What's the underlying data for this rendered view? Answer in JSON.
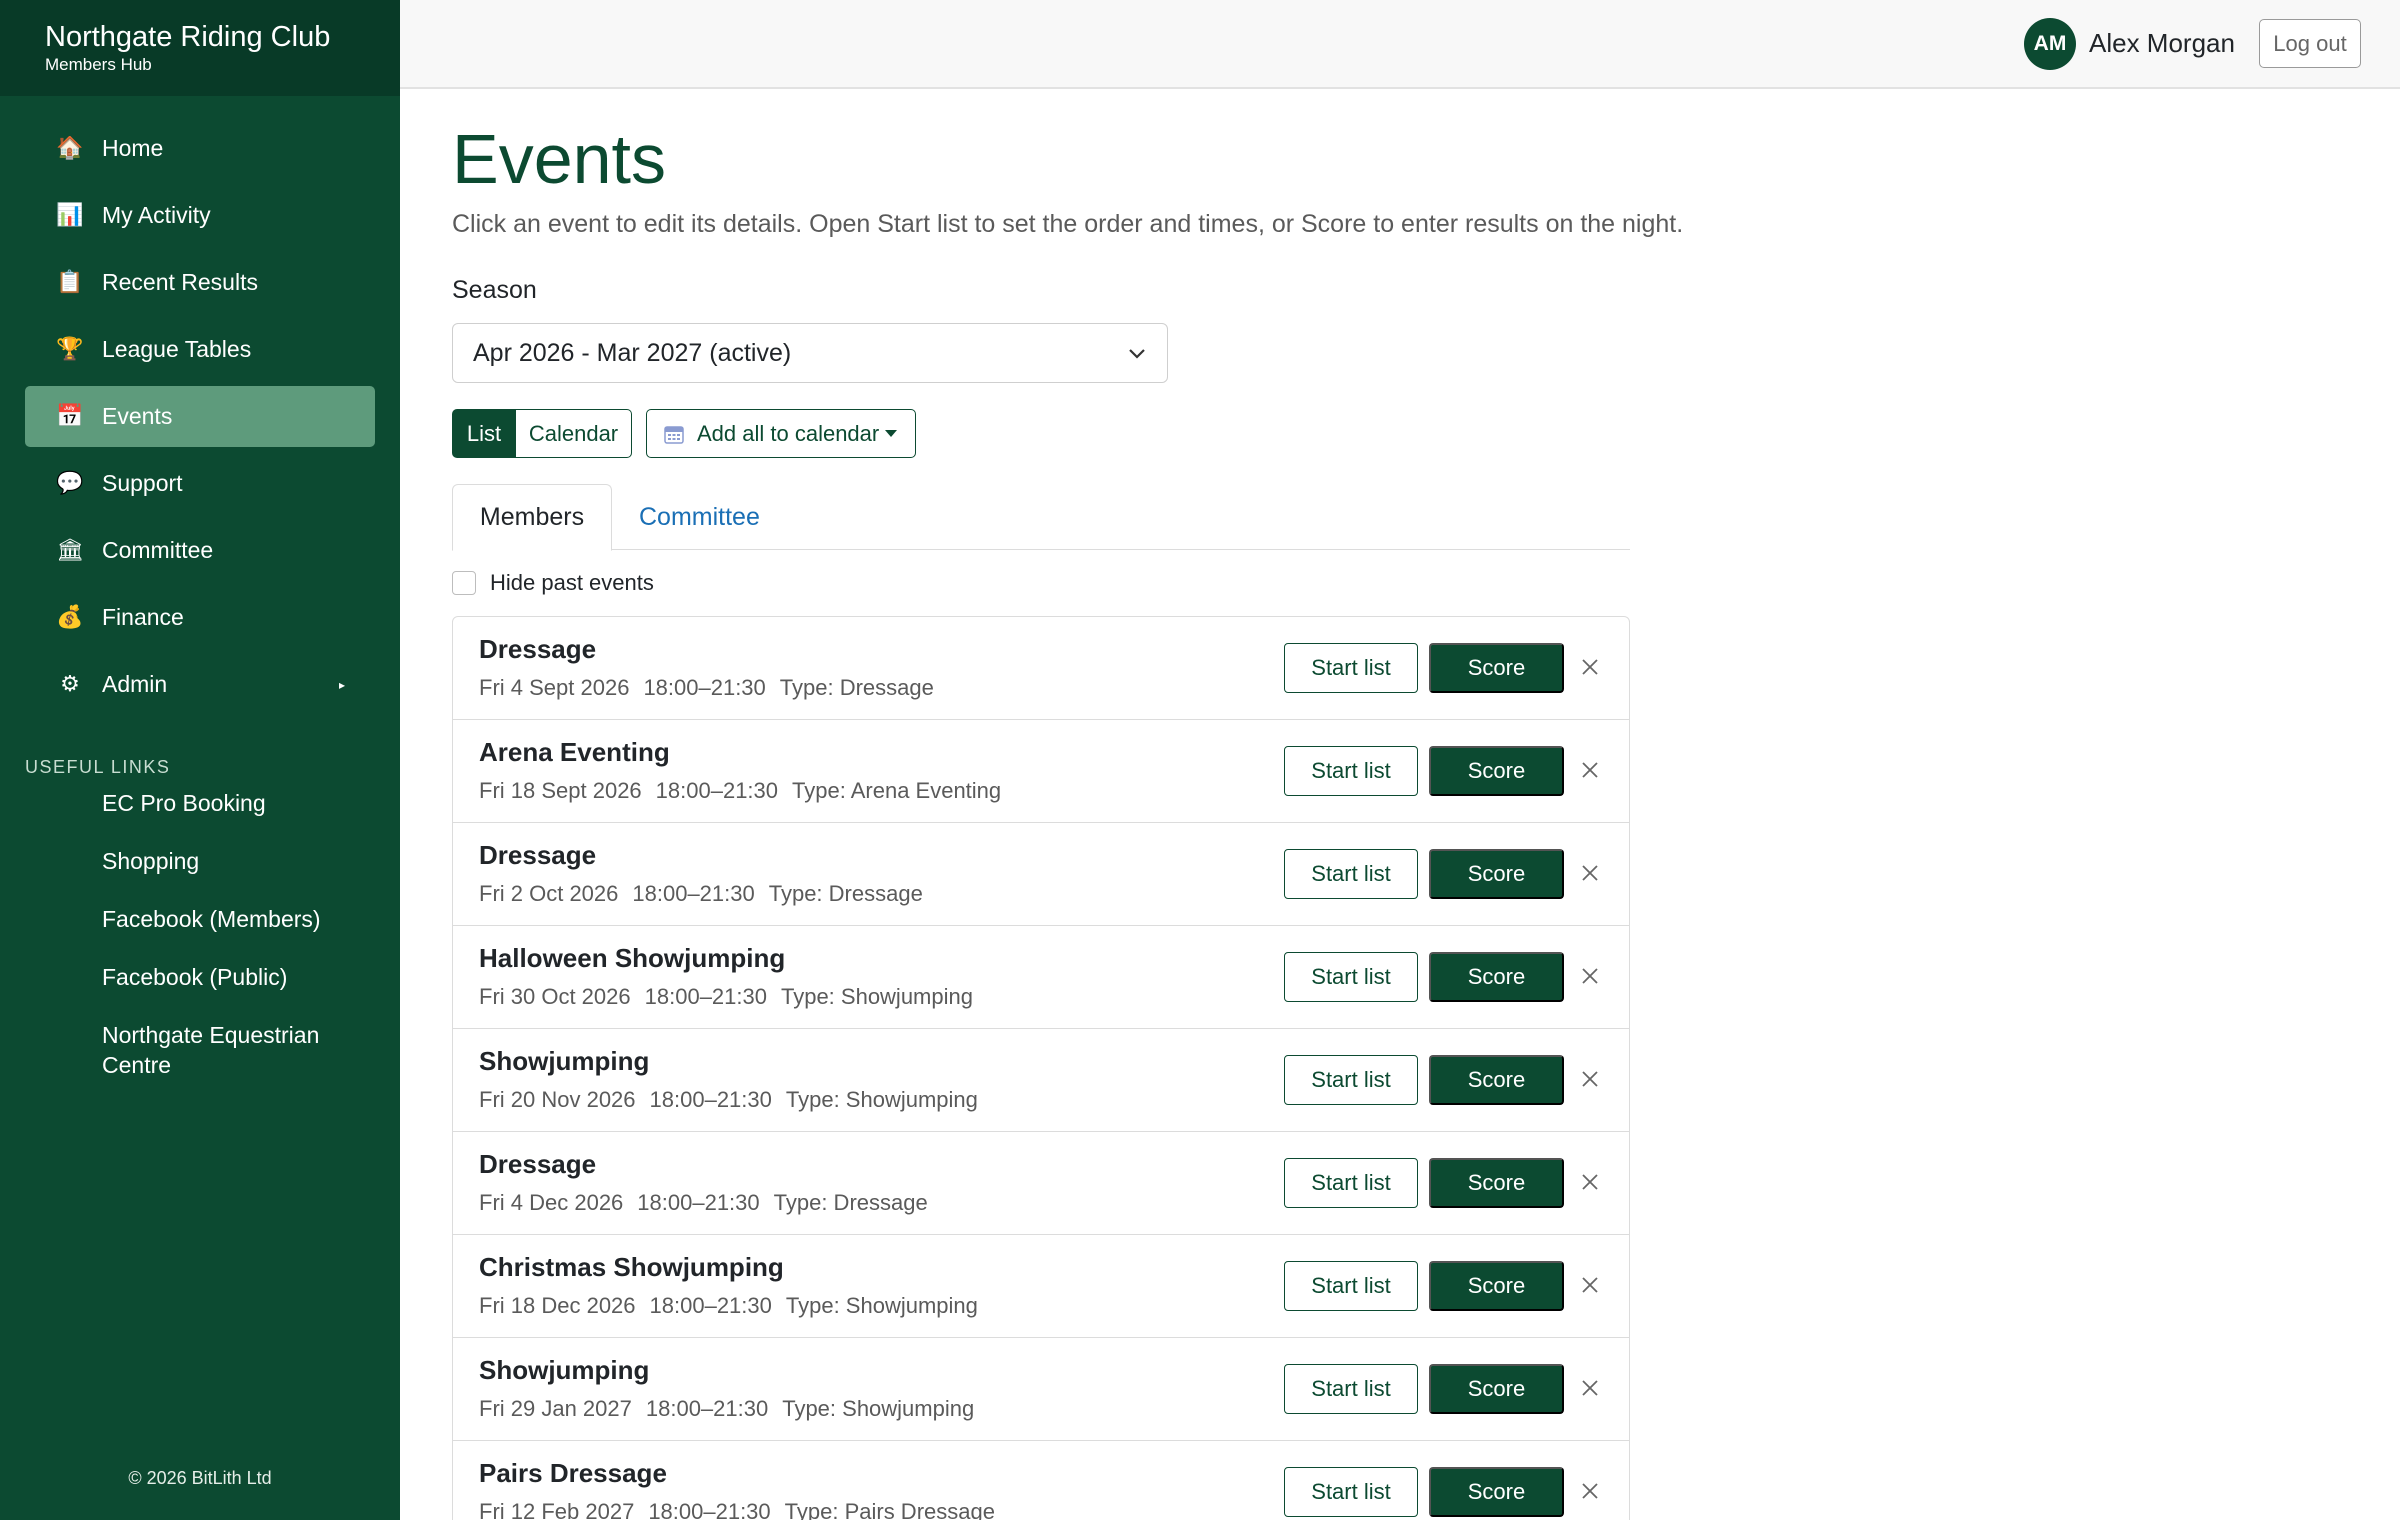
{
  "brand": {
    "title": "Northgate Riding Club",
    "subtitle": "Members Hub"
  },
  "sidebar": {
    "items": [
      {
        "label": "Home",
        "icon": "home-icon",
        "glyph": "🏠"
      },
      {
        "label": "My Activity",
        "icon": "chart-icon",
        "glyph": "📊"
      },
      {
        "label": "Recent Results",
        "icon": "clipboard-icon",
        "glyph": "📋"
      },
      {
        "label": "League Tables",
        "icon": "trophy-icon",
        "glyph": "🏆"
      },
      {
        "label": "Events",
        "icon": "calendar-icon",
        "glyph": "📅",
        "active": true
      },
      {
        "label": "Support",
        "icon": "speech-bubble-icon",
        "glyph": "💬"
      },
      {
        "label": "Committee",
        "icon": "building-icon",
        "glyph": "🏛"
      },
      {
        "label": "Finance",
        "icon": "money-bag-icon",
        "glyph": "💰"
      },
      {
        "label": "Admin",
        "icon": "gear-icon",
        "glyph": "⚙",
        "arrow": "▸"
      }
    ],
    "useful_heading": "USEFUL LINKS",
    "useful_links": [
      "EC Pro Booking",
      "Shopping",
      "Facebook (Members)",
      "Facebook (Public)",
      "Northgate Equestrian Centre"
    ],
    "copyright": "© 2026 BitLith Ltd"
  },
  "header": {
    "avatar_initials": "AM",
    "user_name": "Alex Morgan",
    "logout_label": "Log out"
  },
  "main": {
    "title": "Events",
    "subtitle": "Click an event to edit its details. Open Start list to set the order and times, or Score to enter results on the night.",
    "season_label": "Season",
    "season_value": "Apr 2026 - Mar 2027 (active)",
    "view_list": "List",
    "view_calendar": "Calendar",
    "add_calendar": "Add all to calendar",
    "tabs": [
      "Members",
      "Committee"
    ],
    "hide_past_label": "Hide past events",
    "start_list_label": "Start list",
    "score_label": "Score",
    "events": [
      {
        "name": "Dressage",
        "date": "Fri 4 Sept 2026",
        "time": "18:00–21:30",
        "type": "Type: Dressage"
      },
      {
        "name": "Arena Eventing",
        "date": "Fri 18 Sept 2026",
        "time": "18:00–21:30",
        "type": "Type: Arena Eventing"
      },
      {
        "name": "Dressage",
        "date": "Fri 2 Oct 2026",
        "time": "18:00–21:30",
        "type": "Type: Dressage"
      },
      {
        "name": "Halloween Showjumping",
        "date": "Fri 30 Oct 2026",
        "time": "18:00–21:30",
        "type": "Type: Showjumping"
      },
      {
        "name": "Showjumping",
        "date": "Fri 20 Nov 2026",
        "time": "18:00–21:30",
        "type": "Type: Showjumping"
      },
      {
        "name": "Dressage",
        "date": "Fri 4 Dec 2026",
        "time": "18:00–21:30",
        "type": "Type: Dressage"
      },
      {
        "name": "Christmas Showjumping",
        "date": "Fri 18 Dec 2026",
        "time": "18:00–21:30",
        "type": "Type: Showjumping"
      },
      {
        "name": "Showjumping",
        "date": "Fri 29 Jan 2027",
        "time": "18:00–21:30",
        "type": "Type: Showjumping"
      },
      {
        "name": "Pairs Dressage",
        "date": "Fri 12 Feb 2027",
        "time": "18:00–21:30",
        "type": "Type: Pairs Dressage"
      }
    ]
  },
  "colors": {
    "brand_green": "#0c4a31",
    "active_nav": "#5e9b7c",
    "link_blue": "#1a6fb5"
  }
}
